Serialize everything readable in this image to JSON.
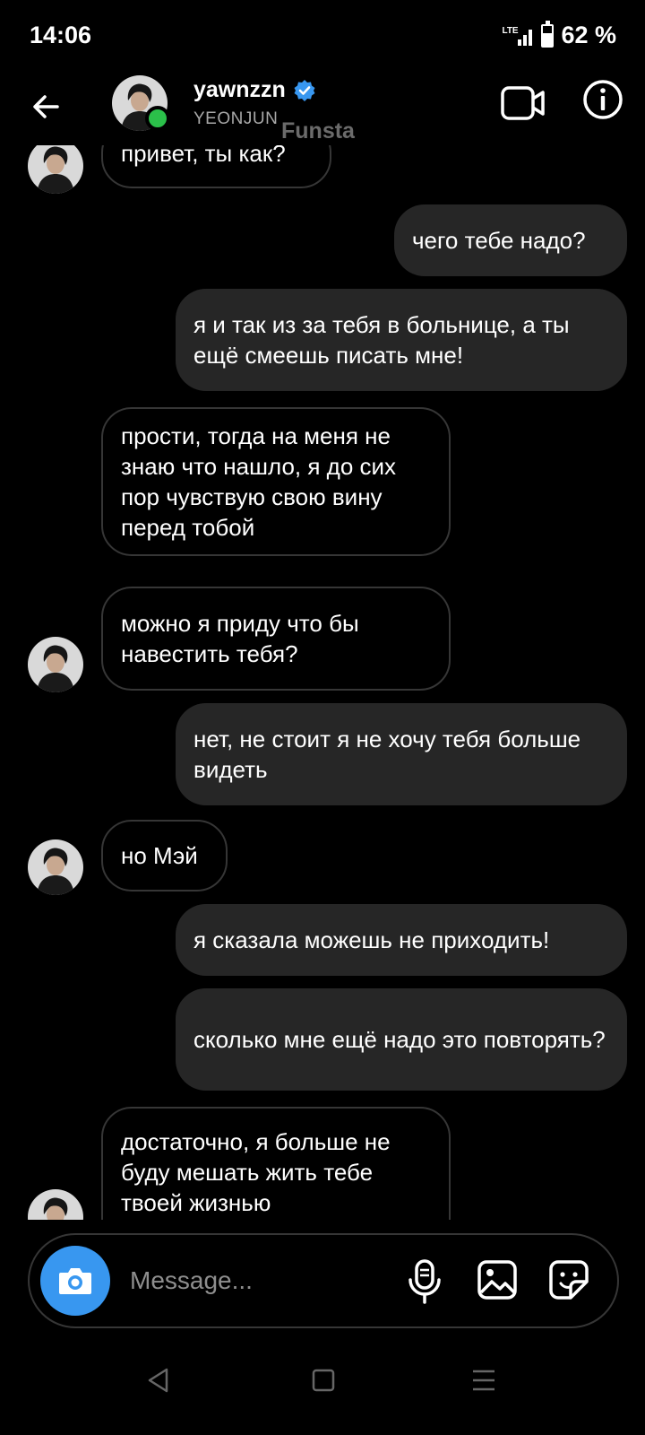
{
  "status_bar": {
    "time": "14:06",
    "network": "LTE",
    "battery": "62 %",
    "battery_level": 0.62
  },
  "header": {
    "username": "yawnzzn",
    "subname": "YEONJUN",
    "overlay_label": "Funsta"
  },
  "messages": [
    {
      "dir": "in",
      "text": "привет, ты как?"
    },
    {
      "dir": "out",
      "text": "чего тебе надо?"
    },
    {
      "dir": "out",
      "text": "я и так из за тебя в больнице, а ты ещё смеешь писать мне!"
    },
    {
      "dir": "in",
      "text": "прости, тогда на меня не знаю что нашло, я до сих пор чувствую свою вину перед тобой"
    },
    {
      "dir": "in",
      "text": "можно я приду что бы навестить тебя?"
    },
    {
      "dir": "out",
      "text": "нет, не стоит я не хочу тебя больше видеть"
    },
    {
      "dir": "in",
      "text": "но Мэй"
    },
    {
      "dir": "out",
      "text": "я сказала можешь не приходить!"
    },
    {
      "dir": "out",
      "text": "сколько мне ещё надо это повторять?"
    },
    {
      "dir": "in",
      "text": "достаточно, я больше не буду мешать жить тебе твоей жизнью"
    }
  ],
  "composer": {
    "placeholder": "Message..."
  },
  "colors": {
    "accent": "#3897f0",
    "online": "#2bc04a",
    "out_bubble": "#262626",
    "in_border": "#363636"
  },
  "icons": [
    "back-arrow-icon",
    "verified-icon",
    "video-call-icon",
    "info-icon",
    "camera-icon",
    "microphone-icon",
    "gallery-icon",
    "sticker-icon"
  ]
}
